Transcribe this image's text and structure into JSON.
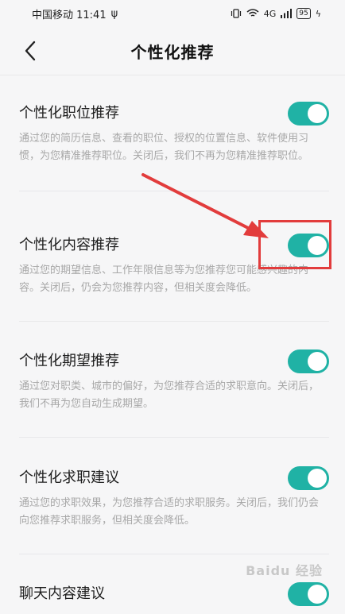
{
  "status_bar": {
    "carrier_time": "中国移动 11:41",
    "usb_glyph": "ψ",
    "network": "4G",
    "battery": "95",
    "charging_glyph": "ϟ"
  },
  "header": {
    "title": "个性化推荐"
  },
  "settings": [
    {
      "title": "个性化职位推荐",
      "description": "通过您的简历信息、查看的职位、授权的位置信息、软件使用习惯，为您精准推荐职位。关闭后，我们不再为您精准推荐职位。",
      "enabled": true
    },
    {
      "title": "个性化内容推荐",
      "description": "通过您的期望信息、工作年限信息等为您推荐您可能感兴趣的内容。关闭后，仍会为您推荐内容，但相关度会降低。",
      "enabled": true
    },
    {
      "title": "个性化期望推荐",
      "description": "通过您对职类、城市的偏好，为您推荐合适的求职意向。关闭后，我们不再为您自动生成期望。",
      "enabled": true
    },
    {
      "title": "个性化求职建议",
      "description": "通过您的求职效果，为您推荐合适的求职服务。关闭后，我们仍会向您推荐求职服务，但相关度会降低。",
      "enabled": true
    },
    {
      "title": "聊天内容建议",
      "description": "",
      "enabled": true
    }
  ],
  "watermark": "Baidu 经验",
  "colors": {
    "toggle_on": "#20b2a5",
    "annotation": "#e23c3c"
  }
}
